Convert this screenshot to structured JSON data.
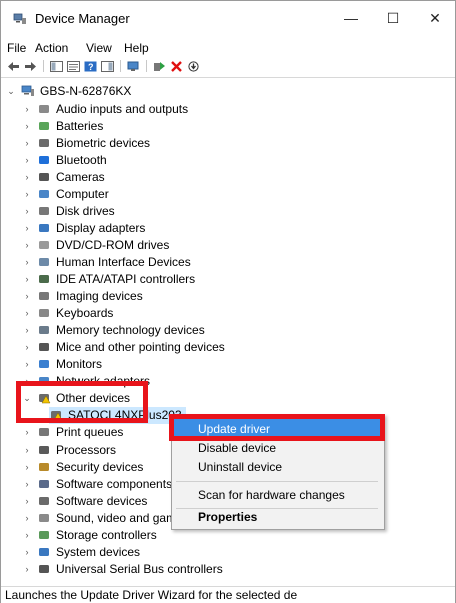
{
  "window": {
    "title": "Device Manager",
    "minimize": "—",
    "maximize": "☐",
    "close": "✕"
  },
  "menu": [
    "File",
    "Action",
    "View",
    "Help"
  ],
  "tree": {
    "root": "GBS-N-62876KX",
    "items": [
      {
        "label": "Audio inputs and outputs",
        "icon": "speaker-icon"
      },
      {
        "label": "Batteries",
        "icon": "battery-icon"
      },
      {
        "label": "Biometric devices",
        "icon": "fingerprint-icon"
      },
      {
        "label": "Bluetooth",
        "icon": "bluetooth-icon"
      },
      {
        "label": "Cameras",
        "icon": "camera-icon"
      },
      {
        "label": "Computer",
        "icon": "computer-icon"
      },
      {
        "label": "Disk drives",
        "icon": "disk-icon"
      },
      {
        "label": "Display adapters",
        "icon": "display-adapter-icon"
      },
      {
        "label": "DVD/CD-ROM drives",
        "icon": "dvd-icon"
      },
      {
        "label": "Human Interface Devices",
        "icon": "hid-icon"
      },
      {
        "label": "IDE ATA/ATAPI controllers",
        "icon": "ide-icon"
      },
      {
        "label": "Imaging devices",
        "icon": "imaging-icon"
      },
      {
        "label": "Keyboards",
        "icon": "keyboard-icon"
      },
      {
        "label": "Memory technology devices",
        "icon": "memory-icon"
      },
      {
        "label": "Mice and other pointing devices",
        "icon": "mouse-icon"
      },
      {
        "label": "Monitors",
        "icon": "monitor-icon"
      },
      {
        "label": "Network adapters",
        "icon": "network-icon"
      },
      {
        "label": "Other devices",
        "icon": "unknown-device-icon"
      },
      {
        "label": "SATOCL4NXPlus203",
        "icon": "warning-device-icon"
      },
      {
        "label": "Print queues",
        "icon": "printer-icon"
      },
      {
        "label": "Processors",
        "icon": "processor-icon"
      },
      {
        "label": "Security devices",
        "icon": "security-icon"
      },
      {
        "label": "Software components",
        "icon": "software-component-icon"
      },
      {
        "label": "Software devices",
        "icon": "software-device-icon"
      },
      {
        "label": "Sound, video and game controllers",
        "icon": "sound-icon"
      },
      {
        "label": "Storage controllers",
        "icon": "storage-icon"
      },
      {
        "label": "System devices",
        "icon": "system-icon"
      },
      {
        "label": "Universal Serial Bus controllers",
        "icon": "usb-icon"
      }
    ]
  },
  "context_menu": {
    "update_driver": "Update driver",
    "disable_device": "Disable device",
    "uninstall_device": "Uninstall device",
    "scan": "Scan for hardware changes",
    "properties": "Properties"
  },
  "status": "Launches the Update Driver Wizard for the selected de",
  "colors": {
    "highlight_box": "#e8141b",
    "menu_selected": "#3b8ee5"
  }
}
